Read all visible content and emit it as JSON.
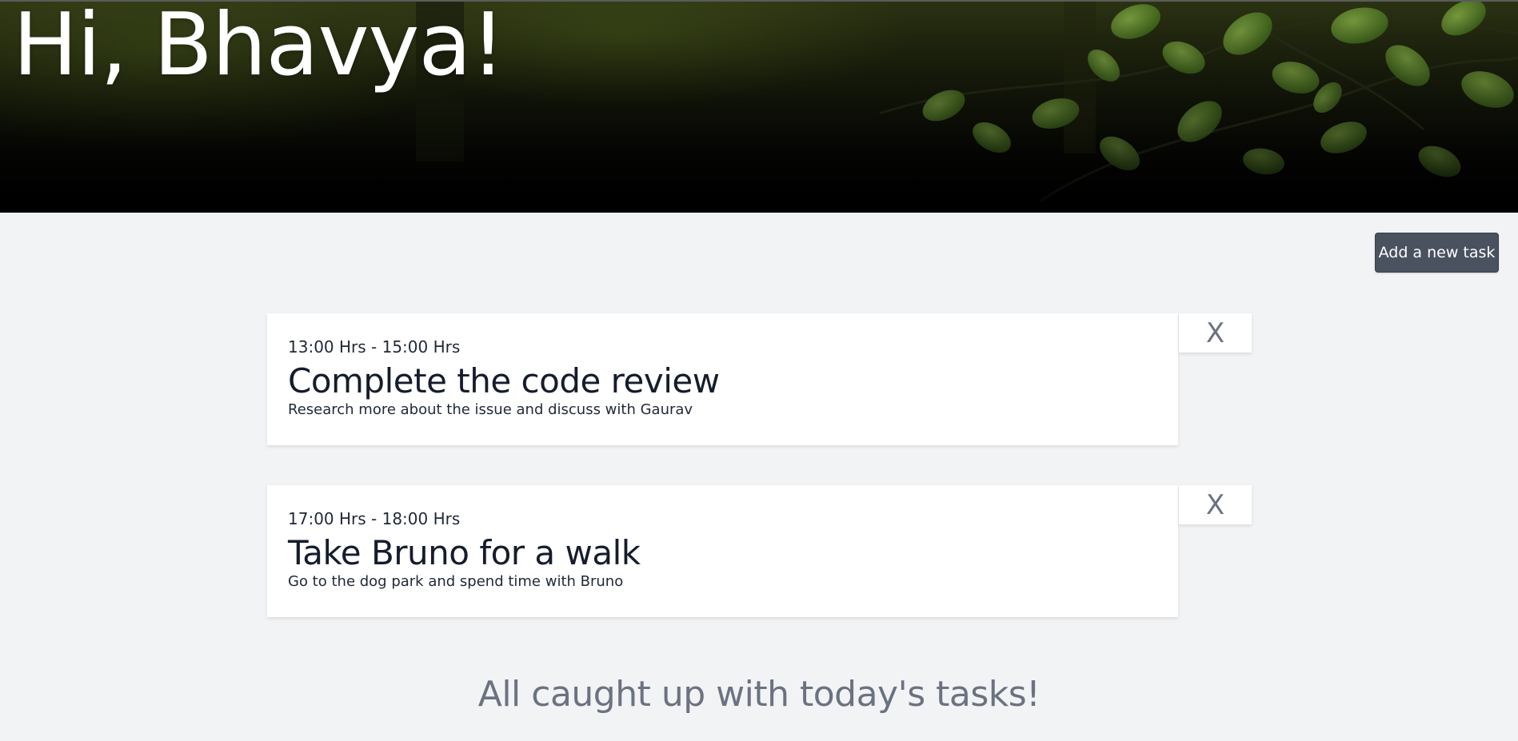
{
  "header": {
    "greeting": "Hi, Bhavya!"
  },
  "toolbar": {
    "add_task_label": "Add a new task"
  },
  "tasks": [
    {
      "time": "13:00 Hrs - 15:00 Hrs",
      "title": "Complete the code review",
      "description": "Research more about the issue and discuss with Gaurav",
      "delete_label": "X"
    },
    {
      "time": "17:00 Hrs - 18:00 Hrs",
      "title": "Take Bruno for a walk",
      "description": "Go to the dog park and spend time with Bruno",
      "delete_label": "X"
    }
  ],
  "footer": {
    "status_message": "All caught up with today's tasks!"
  },
  "colors": {
    "page_background": "#f2f3f5",
    "button_background": "#4a5260",
    "card_background": "#ffffff",
    "muted_text": "#6b7280"
  }
}
